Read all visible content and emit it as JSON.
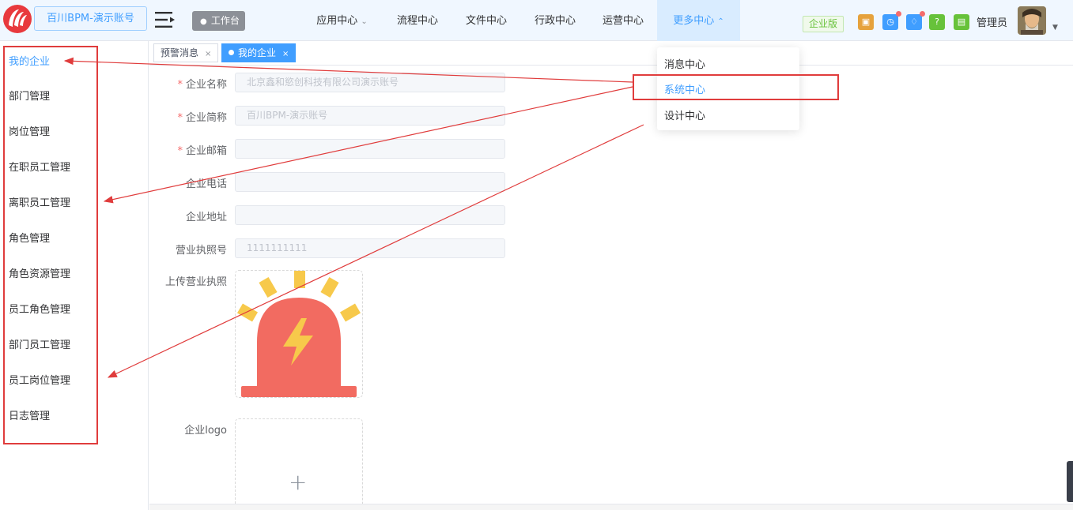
{
  "header": {
    "brand": "百川BPM-演示账号",
    "workbench_label": "工作台",
    "nav": [
      {
        "label": "应用中心",
        "has_chevron": true
      },
      {
        "label": "流程中心"
      },
      {
        "label": "文件中心"
      },
      {
        "label": "行政中心"
      },
      {
        "label": "运营中心"
      },
      {
        "label": "更多中心",
        "has_chevron": true,
        "active": true
      }
    ],
    "edition_badge": "企业版",
    "icons": [
      {
        "name": "note-icon",
        "color": "#e6a23c"
      },
      {
        "name": "clock-icon",
        "color": "#409eff",
        "badge": true
      },
      {
        "name": "bell-icon",
        "color": "#409eff",
        "badge": true
      },
      {
        "name": "help-icon",
        "color": "#67c23a"
      },
      {
        "name": "bag-icon",
        "color": "#67c23a"
      }
    ],
    "user_name": "管理员"
  },
  "sidebar": {
    "items": [
      {
        "label": "我的企业",
        "active": true
      },
      {
        "label": "部门管理"
      },
      {
        "label": "岗位管理"
      },
      {
        "label": "在职员工管理"
      },
      {
        "label": "离职员工管理"
      },
      {
        "label": "角色管理"
      },
      {
        "label": "角色资源管理"
      },
      {
        "label": "员工角色管理"
      },
      {
        "label": "部门员工管理"
      },
      {
        "label": "员工岗位管理"
      },
      {
        "label": "日志管理"
      }
    ]
  },
  "tabs": [
    {
      "label": "预警消息",
      "close": "×"
    },
    {
      "label": "我的企业",
      "close": "×",
      "active": true
    }
  ],
  "form": {
    "company_name": {
      "label": "企业名称",
      "required": true,
      "value": "北京鑫和慾创科技有限公司演示账号"
    },
    "company_short": {
      "label": "企业简称",
      "required": true,
      "value": "百川BPM-演示账号"
    },
    "company_email": {
      "label": "企业邮箱",
      "required": true,
      "value": ""
    },
    "company_phone": {
      "label": "企业电话",
      "value": ""
    },
    "company_address": {
      "label": "企业地址",
      "value": ""
    },
    "license_no": {
      "label": "营业执照号",
      "value": "1111111111"
    },
    "license_upload": {
      "label": "上传营业执照"
    },
    "logo_upload": {
      "label": "企业logo",
      "plus": "+"
    }
  },
  "dropdown": {
    "items": [
      {
        "label": "消息中心"
      },
      {
        "label": "系统中心",
        "active": true
      },
      {
        "label": "设计中心"
      }
    ]
  },
  "colors": {
    "primary": "#409eff",
    "annotation_red": "#e03c3c"
  }
}
